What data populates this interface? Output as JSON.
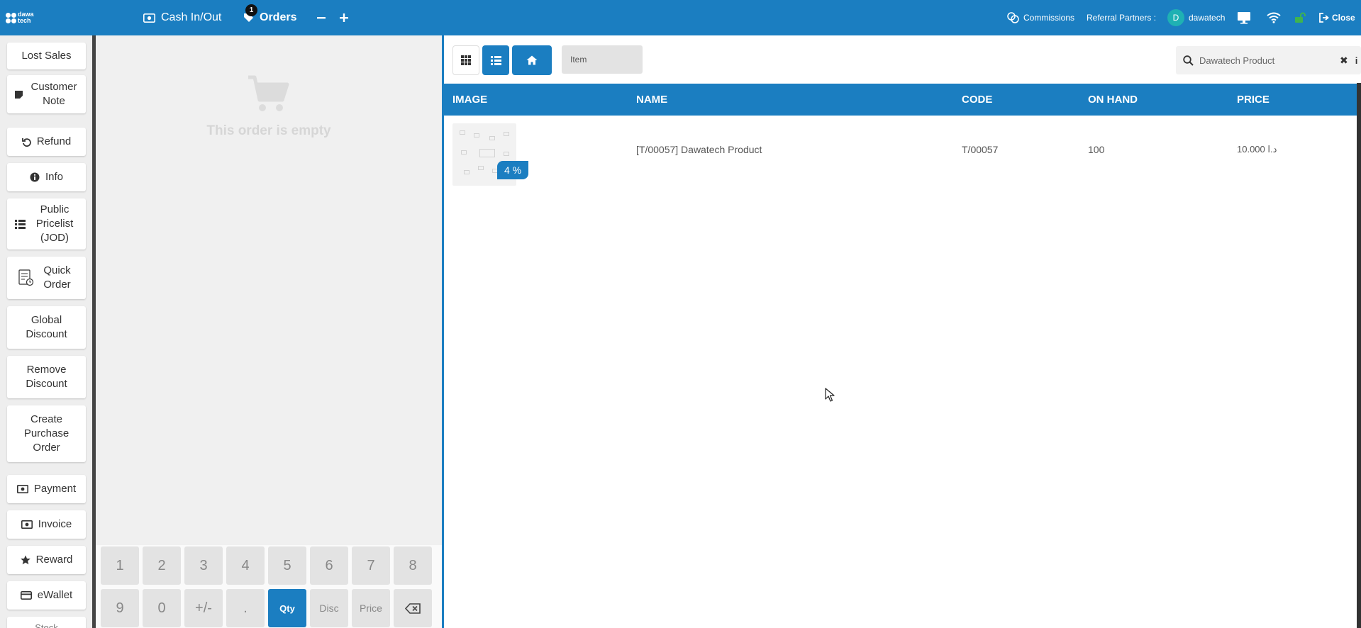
{
  "topbar": {
    "brand": "dawa tech",
    "cash_in_out": "Cash In/Out",
    "orders_label": "Orders",
    "orders_count": "1",
    "commissions": "Commissions",
    "referral_partners": "Referral Partners :",
    "avatar_initial": "D",
    "user_name": "dawatech",
    "close_label": "Close",
    "colors": {
      "bar": "#1b7ec1",
      "lock": "#3fb34f",
      "avatar": "#1fb1b3"
    }
  },
  "actions": {
    "lost_sales": "Lost Sales",
    "customer_note": "Customer Note",
    "refund": "Refund",
    "info": "Info",
    "pricelist": "Public Pricelist (JOD)",
    "quick_order": "Quick Order",
    "global_discount": "Global Discount",
    "remove_discount": "Remove Discount",
    "create_po": "Create Purchase Order",
    "payment": "Payment",
    "invoice": "Invoice",
    "reward": "Reward",
    "ewallet": "eWallet",
    "next_partial": "Stock"
  },
  "order": {
    "empty_message": "This order is empty"
  },
  "numpad": {
    "keys": [
      "1",
      "2",
      "3",
      "4",
      "5",
      "6",
      "7",
      "8",
      "9",
      "0",
      "+/-",
      "."
    ],
    "qty": "Qty",
    "disc": "Disc",
    "price": "Price"
  },
  "products": {
    "breadcrumb": "Item",
    "search_value": "Dawatech Product",
    "columns": {
      "image": "IMAGE",
      "name": "NAME",
      "code": "CODE",
      "on_hand": "ON HAND",
      "price": "PRICE"
    },
    "rows": [
      {
        "name": "[T/00057] Dawatech Product",
        "code": "T/00057",
        "on_hand": "100",
        "price": "10.000 د.ا",
        "discount_badge": "4 %"
      }
    ]
  }
}
